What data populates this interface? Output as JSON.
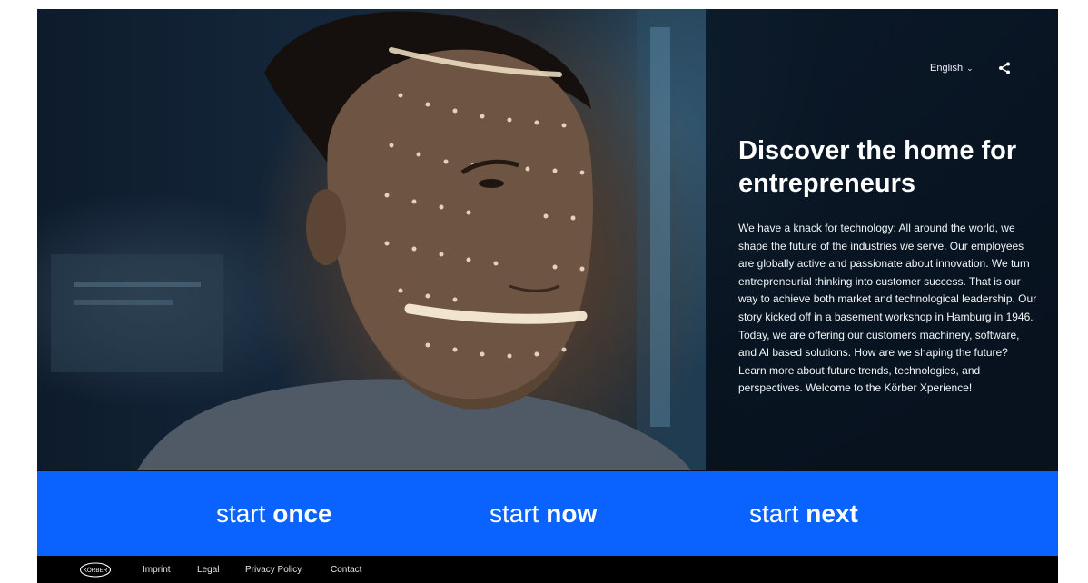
{
  "header": {
    "language": "English",
    "language_icon": "chevron-down-icon",
    "share_icon": "share-icon"
  },
  "hero": {
    "headline": "Discover the home for entrepreneurs",
    "intro": "We have a knack for technology: All around the world, we shape the future of the industries we serve. Our employees are globally active and passionate about innovation. We turn entrepreneurial thinking into customer success. That is our way to achieve both market and technological leadership. Our story kicked off in a basement workshop in Hamburg in 1946. Today, we are offering our customers machinery, software, and AI based solutions. How are we shaping the future? Learn more about future trends, technologies, and perspectives. Welcome to the Körber Xperience!"
  },
  "cta": [
    {
      "prefix": "start",
      "emphasis": "once"
    },
    {
      "prefix": "start",
      "emphasis": "now"
    },
    {
      "prefix": "start",
      "emphasis": "next"
    }
  ],
  "footer": {
    "logo_text": "KÖRBER",
    "links": [
      "Imprint",
      "Legal",
      "Privacy Policy",
      "Contact"
    ]
  },
  "colors": {
    "cta_blue": "#0a63ff",
    "footer_bg": "#000000",
    "panel_bg": "#081422"
  }
}
